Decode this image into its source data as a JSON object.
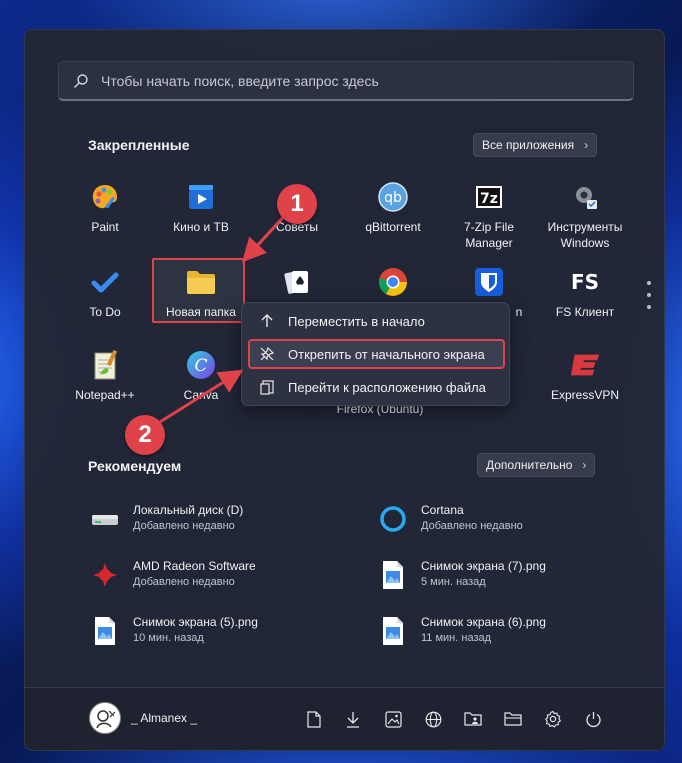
{
  "search": {
    "placeholder": "Чтобы начать поиск, введите запрос здесь"
  },
  "pinned": {
    "title": "Закрепленные",
    "all_apps_label": "Все приложения",
    "apps": [
      {
        "label": "Paint",
        "icon": "paint-icon"
      },
      {
        "label": "Кино и ТВ",
        "icon": "movies-tv-icon"
      },
      {
        "label": "Советы",
        "icon": "tips-icon"
      },
      {
        "label": "qBittorrent",
        "icon": "qbittorrent-icon"
      },
      {
        "label": "7-Zip File Manager",
        "icon": "7zip-icon"
      },
      {
        "label": "Инструменты Windows",
        "icon": "windows-tools-icon"
      },
      {
        "label": "To Do",
        "icon": "todo-icon"
      },
      {
        "label": "Новая папка",
        "icon": "folder-icon"
      },
      {
        "label": "",
        "icon": "solitaire-icon"
      },
      {
        "label": "",
        "icon": "chrome-icon"
      },
      {
        "label": "n",
        "icon": "bitwarden-icon"
      },
      {
        "label": "FS Клиент",
        "icon": "fs-client-icon"
      },
      {
        "label": "Notepad++",
        "icon": "notepadpp-icon"
      },
      {
        "label": "Canva",
        "icon": "canva-icon"
      },
      {
        "label": "Firefox (Ubuntu)",
        "icon": "firefox-ubuntu-icon"
      },
      {
        "label": "ExpressVPN",
        "icon": "expressvpn-icon"
      }
    ]
  },
  "context_menu": {
    "items": [
      {
        "label": "Переместить в начало",
        "icon": "arrow-up-icon"
      },
      {
        "label": "Открепить от начального экрана",
        "icon": "unpin-icon"
      },
      {
        "label": "Перейти к расположению файла",
        "icon": "open-file-location-icon"
      }
    ]
  },
  "recommended": {
    "title": "Рекомендуем",
    "more_label": "Дополнительно",
    "items": [
      {
        "title": "Локальный диск (D)",
        "sub": "Добавлено недавно",
        "icon": "drive-icon"
      },
      {
        "title": "Cortana",
        "sub": "Добавлено недавно",
        "icon": "cortana-icon"
      },
      {
        "title": "AMD Radeon Software",
        "sub": "Добавлено недавно",
        "icon": "amd-icon"
      },
      {
        "title": "Снимок экрана (7).png",
        "sub": "5 мин. назад",
        "icon": "image-file-icon"
      },
      {
        "title": "Снимок экрана (5).png",
        "sub": "10 мин. назад",
        "icon": "image-file-icon"
      },
      {
        "title": "Снимок экрана (6).png",
        "sub": "11 мин. назад",
        "icon": "image-file-icon"
      }
    ]
  },
  "footer": {
    "user_name": "_ Almanex _",
    "buttons": [
      "documents-icon",
      "downloads-icon",
      "pictures-icon",
      "network-icon",
      "user-folder-icon",
      "explorer-icon",
      "settings-icon",
      "power-icon"
    ]
  },
  "annotations": {
    "badge1": "1",
    "badge2": "2",
    "color": "#e0424a"
  }
}
